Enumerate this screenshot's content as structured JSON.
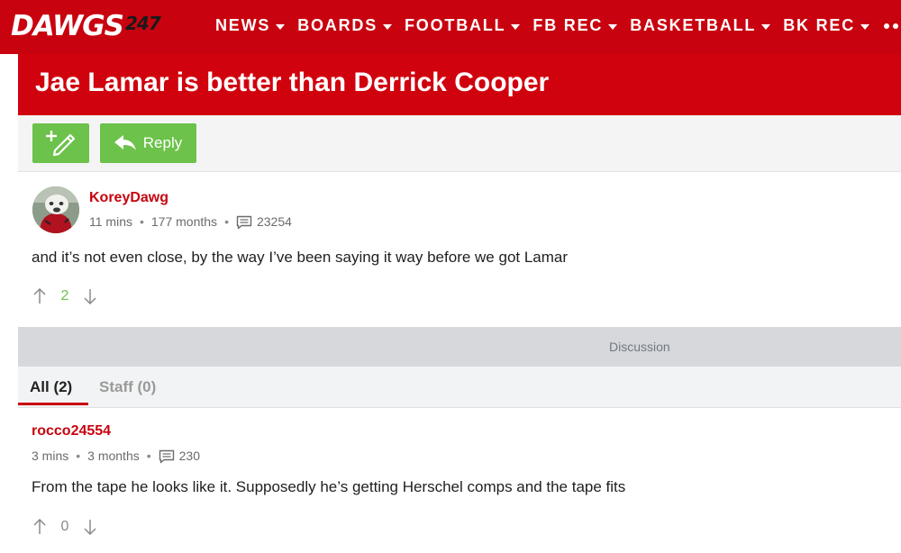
{
  "brand": {
    "name": "DAWGS",
    "suffix": "247"
  },
  "nav": {
    "items": [
      {
        "label": "NEWS"
      },
      {
        "label": "BOARDS"
      },
      {
        "label": "FOOTBALL"
      },
      {
        "label": "FB REC"
      },
      {
        "label": "BASKETBALL"
      },
      {
        "label": "BK REC"
      }
    ],
    "more_icon": "ellipsis-icon"
  },
  "thread": {
    "title": "Jae Lamar is better than Derrick Cooper"
  },
  "actions": {
    "new_icon": "new-post-pencil-icon",
    "reply_label": "Reply",
    "reply_icon": "reply-arrow-icon"
  },
  "post": {
    "author": "KoreyDawg",
    "time": "11 mins",
    "member_since": "177 months",
    "post_count": "23254",
    "body": "and it’s not even close, by the way I’ve been saying it way before we got Lamar",
    "votes": "2"
  },
  "discussion": {
    "label": "Discussion"
  },
  "tabs": [
    {
      "label": "All (2)",
      "active": true
    },
    {
      "label": "Staff (0)",
      "active": false
    }
  ],
  "reply": {
    "author": "rocco24554",
    "time": "3 mins",
    "member_since": "3 months",
    "post_count": "230",
    "body": "From the tape he looks like it. Supposedly he’s getting Herschel comps and the tape fits",
    "votes": "0"
  },
  "colors": {
    "brand_red": "#c8030f",
    "action_green": "#6cc24a",
    "upvote_green": "#6cc24a",
    "discussion_gray": "#d6d8dc"
  }
}
